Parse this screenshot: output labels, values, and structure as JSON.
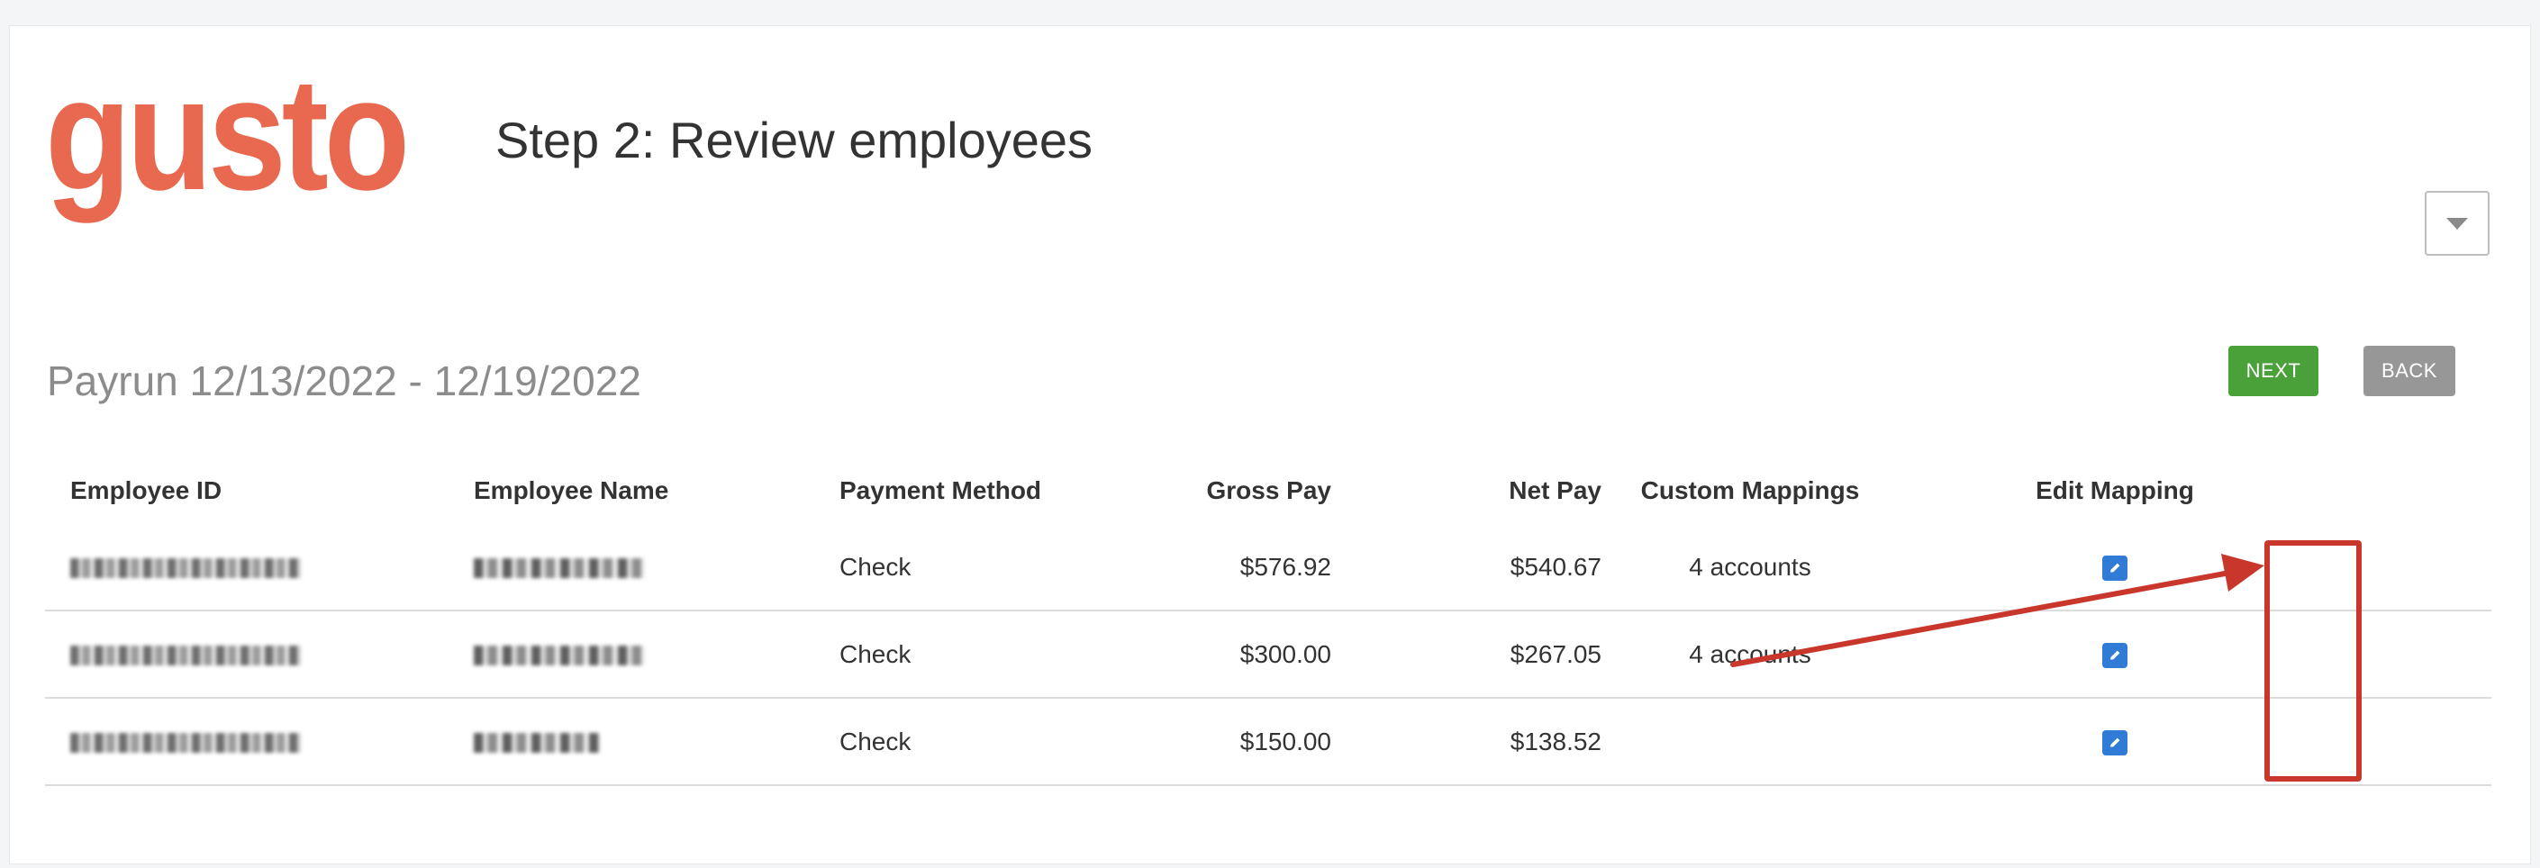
{
  "brand": {
    "logo_text": "gusto",
    "logo_color": "#e8694f"
  },
  "header": {
    "step_title": "Step 2: Review employees"
  },
  "payrun": {
    "title": "Payrun 12/13/2022 - 12/19/2022"
  },
  "actions": {
    "next_label": "NEXT",
    "back_label": "BACK",
    "next_color": "#4aa13a",
    "back_color": "#979797"
  },
  "table": {
    "headers": {
      "employee_id": "Employee ID",
      "employee_name": "Employee Name",
      "payment_method": "Payment Method",
      "gross_pay": "Gross Pay",
      "net_pay": "Net Pay",
      "custom_mappings": "Custom Mappings",
      "edit_mapping": "Edit Mapping"
    },
    "rows": [
      {
        "payment_method": "Check",
        "gross_pay": "$576.92",
        "net_pay": "$540.67",
        "custom_mappings": "4 accounts"
      },
      {
        "payment_method": "Check",
        "gross_pay": "$300.00",
        "net_pay": "$267.05",
        "custom_mappings": "4 accounts"
      },
      {
        "payment_method": "Check",
        "gross_pay": "$150.00",
        "net_pay": "$138.52",
        "custom_mappings": ""
      }
    ]
  },
  "icons": {
    "edit": "pencil-icon",
    "dropdown": "caret-down-icon"
  },
  "annotation": {
    "color": "#c9372c"
  }
}
